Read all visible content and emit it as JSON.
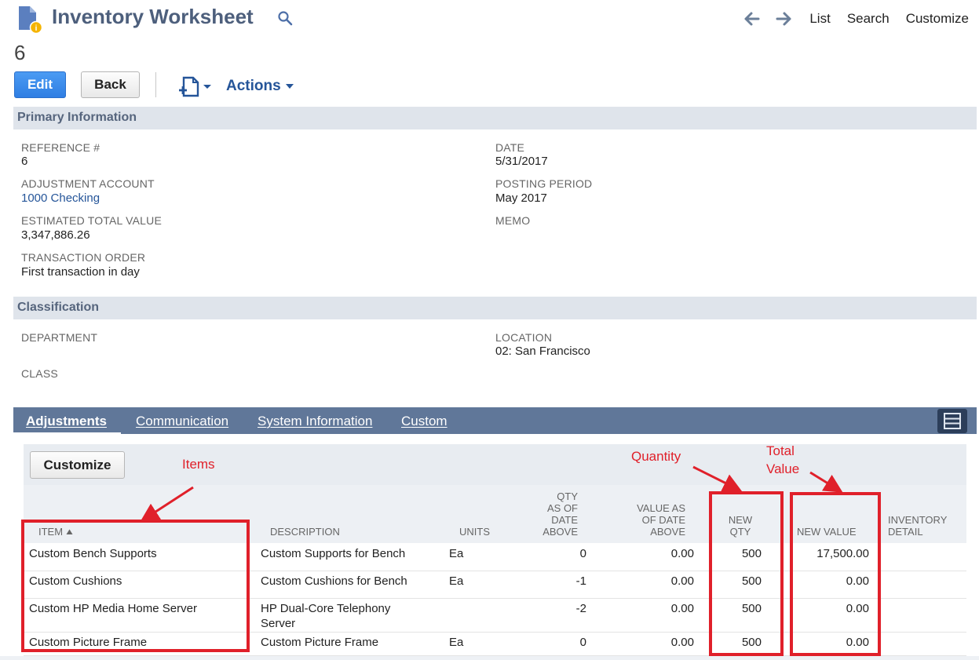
{
  "header": {
    "title": "Inventory Worksheet",
    "record_number": "6",
    "nav": {
      "list": "List",
      "search": "Search",
      "customize": "Customize"
    }
  },
  "toolbar": {
    "edit": "Edit",
    "back": "Back",
    "actions": "Actions"
  },
  "primary": {
    "heading": "Primary Information",
    "reference_label": "REFERENCE #",
    "reference_value": "6",
    "account_label": "ADJUSTMENT ACCOUNT",
    "account_value": "1000 Checking",
    "est_label": "ESTIMATED TOTAL VALUE",
    "est_value": "3,347,886.26",
    "order_label": "TRANSACTION ORDER",
    "order_value": "First transaction in day",
    "date_label": "DATE",
    "date_value": "5/31/2017",
    "period_label": "POSTING PERIOD",
    "period_value": "May 2017",
    "memo_label": "MEMO"
  },
  "classification": {
    "heading": "Classification",
    "department_label": "DEPARTMENT",
    "class_label": "CLASS",
    "location_label": "LOCATION",
    "location_value": "02: San Francisco"
  },
  "tabs": [
    {
      "key": "A",
      "rest": "djustments"
    },
    {
      "key": "C",
      "rest": "ommunication"
    },
    {
      "key": "S",
      "rest": "ystem Information"
    },
    {
      "key": "C",
      "rest": "ustom"
    }
  ],
  "sublist": {
    "customize": "Customize",
    "columns": {
      "item": "ITEM",
      "description": "DESCRIPTION",
      "units": "UNITS",
      "qty_as_of": [
        "QTY",
        "AS OF",
        "DATE",
        "ABOVE"
      ],
      "value_as_of": [
        "VALUE AS",
        "OF DATE",
        "ABOVE"
      ],
      "new_qty": [
        "NEW",
        "QTY"
      ],
      "new_value": "NEW VALUE",
      "inventory_detail": [
        "INVENTORY",
        "DETAIL"
      ]
    },
    "rows": [
      {
        "item": "Custom Bench Supports",
        "description": [
          "Custom Supports for Bench"
        ],
        "units": "Ea",
        "qty": "0",
        "value": "0.00",
        "new_qty": "500",
        "new_value": "17,500.00"
      },
      {
        "item": "Custom Cushions",
        "description": [
          "Custom Cushions for Bench"
        ],
        "units": "Ea",
        "qty": "-1",
        "value": "0.00",
        "new_qty": "500",
        "new_value": "0.00"
      },
      {
        "item": "Custom HP Media Home Server",
        "description": [
          "HP Dual-Core Telephony",
          "Server"
        ],
        "units": "",
        "qty": "-2",
        "value": "0.00",
        "new_qty": "500",
        "new_value": "0.00"
      },
      {
        "item": "Custom Picture Frame",
        "description": [
          "Custom Picture Frame"
        ],
        "units": "Ea",
        "qty": "0",
        "value": "0.00",
        "new_qty": "500",
        "new_value": "0.00"
      }
    ]
  },
  "annotations": {
    "items": "Items",
    "quantity": "Quantity",
    "total_value": [
      "Total",
      "Value"
    ]
  },
  "colors": {
    "accent_blue": "#2f7ee3",
    "link": "#255599",
    "annotation_red": "#e0202a",
    "tab_bar": "#607799"
  },
  "icons": [
    "record-icon",
    "search-icon",
    "back-arrow-icon",
    "forward-arrow-icon",
    "new-document-icon",
    "caret-down-icon",
    "sort-up-icon",
    "column-menu-icon"
  ]
}
